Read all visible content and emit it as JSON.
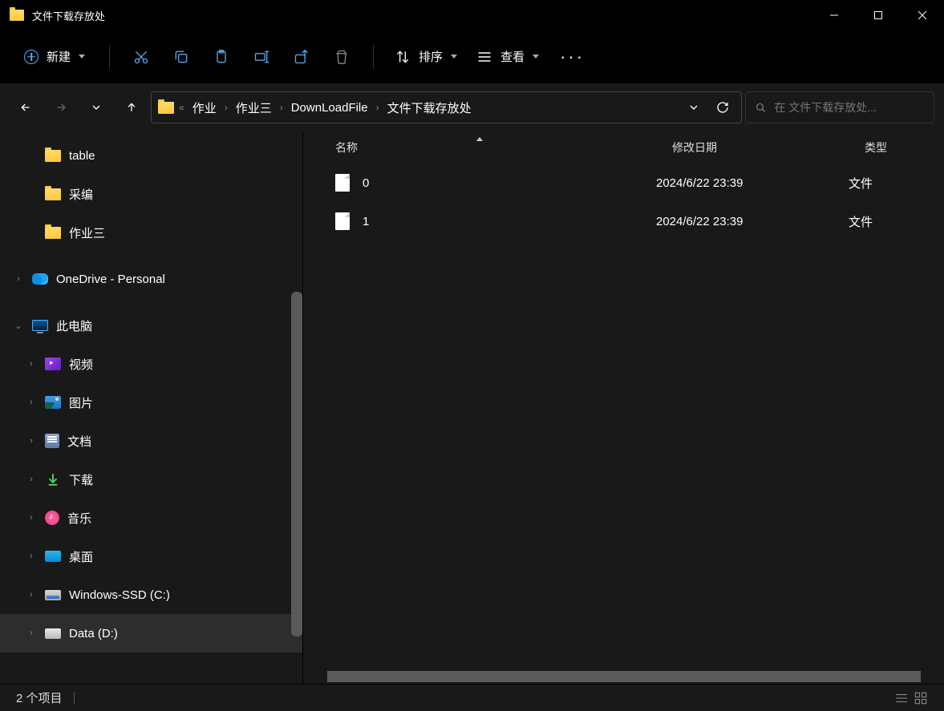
{
  "window": {
    "title": "文件下载存放处"
  },
  "toolbar": {
    "new_label": "新建",
    "sort_label": "排序",
    "view_label": "查看"
  },
  "breadcrumb": {
    "items": [
      "作业",
      "作业三",
      "DownLoadFile",
      "文件下载存放处"
    ]
  },
  "search": {
    "placeholder": "在 文件下载存放处..."
  },
  "columns": {
    "name": "名称",
    "date": "修改日期",
    "type": "类型"
  },
  "files": [
    {
      "name": "0",
      "date": "2024/6/22 23:39",
      "type": "文件"
    },
    {
      "name": "1",
      "date": "2024/6/22 23:39",
      "type": "文件"
    }
  ],
  "sidebar": {
    "folders": [
      "table",
      "采编",
      "作业三"
    ],
    "onedrive": "OneDrive - Personal",
    "thispc": "此电脑",
    "libs": {
      "video": "视频",
      "image": "图片",
      "doc": "文档",
      "download": "下载",
      "music": "音乐",
      "desktop": "桌面"
    },
    "drives": [
      "Windows-SSD (C:)",
      "Data (D:)"
    ]
  },
  "status": {
    "count": "2 个项目"
  }
}
